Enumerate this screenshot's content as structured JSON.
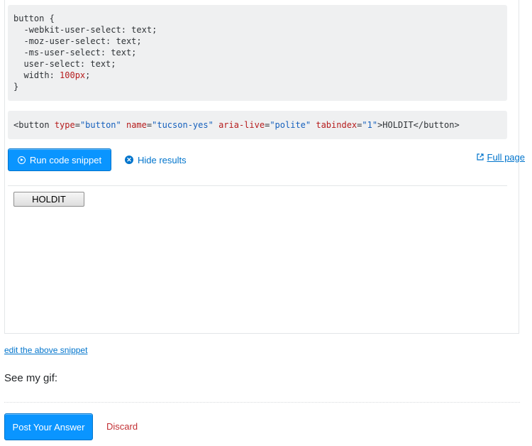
{
  "snippet": {
    "css_lines": [
      "button {",
      "  -webkit-user-select: text;",
      "  -moz-user-select: text;",
      "  -ms-user-select: text;",
      "  user-select: text;",
      "  width: ",
      "}"
    ],
    "css_width_value": "100px",
    "css_width_suffix": ";",
    "html_code": {
      "open_tag": "<button",
      "attr1_name": "type",
      "attr1_value": "\"button\"",
      "attr2_name": "name",
      "attr2_value": "\"tucson-yes\"",
      "attr3_name": "aria-live",
      "attr3_value": "\"polite\"",
      "attr4_name": "tabindex",
      "attr4_value": "\"1\"",
      "content": ">HOLDIT",
      "close_tag": "</button>",
      "close_bracket": ">"
    },
    "run_button_label": "Run code snippet",
    "hide_results_label": "Hide results",
    "full_page_label": "Full page",
    "result_button_label": "HOLDIT"
  },
  "edit_snippet_link": "edit the above snippet",
  "body_text": "See my gif:",
  "post_answer_label": "Post Your Answer",
  "discard_label": "Discard",
  "colors": {
    "accent": "#0a95ff",
    "link": "#0074cc",
    "discard": "#c22e32",
    "code_bg": "#eff0f1"
  },
  "icons": [
    "play-circle-icon",
    "close-circle-icon",
    "external-link-icon"
  ]
}
